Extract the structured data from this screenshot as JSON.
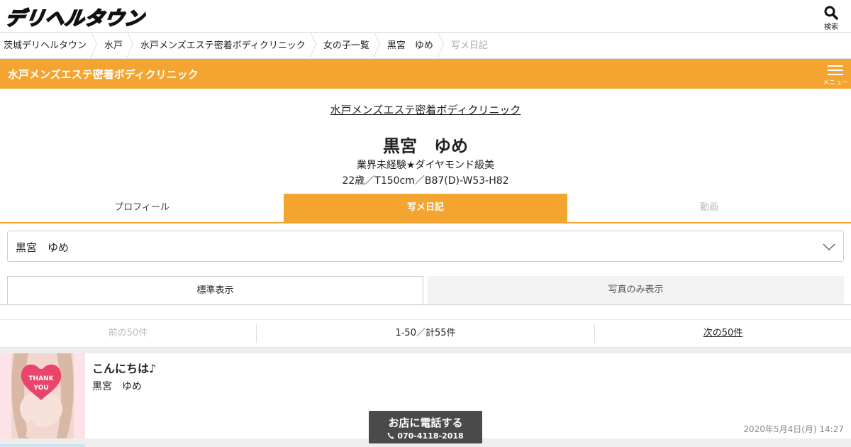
{
  "header": {
    "logo_text": "デリヘルタウン",
    "search_label": "検索"
  },
  "breadcrumb": [
    {
      "label": "茨城デリヘルタウン"
    },
    {
      "label": "水戸"
    },
    {
      "label": "水戸メンズエステ密着ボディクリニック"
    },
    {
      "label": "女の子一覧"
    },
    {
      "label": "黒宮　ゆめ"
    },
    {
      "label": "写メ日記"
    }
  ],
  "shop_bar": {
    "title": "水戸メンズエステ密着ボディクリニック",
    "menu_label": "メニュー"
  },
  "profile": {
    "shop_link": "水戸メンズエステ密着ボディクリニック",
    "name": "黒宮　ゆめ",
    "catch": "業界未経験★ダイヤモンド級美",
    "spec": "22歳／T150cm／B87(D)-W53-H82"
  },
  "tabs": [
    {
      "label": "プロフィール",
      "state": "normal"
    },
    {
      "label": "写メ日記",
      "state": "active"
    },
    {
      "label": "動画",
      "state": "disabled"
    }
  ],
  "girl_select": {
    "value": "黒宮　ゆめ"
  },
  "view_toggle": {
    "standard_label": "標準表示",
    "photo_only_label": "写真のみ表示"
  },
  "pager": {
    "prev_label": "前の50件",
    "count_label": "1-50／計55件",
    "next_label": "次の50件"
  },
  "diary_items": [
    {
      "title": "こんにちは♪",
      "author": "黒宮　ゆめ",
      "date": "2020年5月4日(月) 14:27",
      "thumb_text_1": "THANK",
      "thumb_text_2": "YOU"
    }
  ],
  "call_button": {
    "label": "お店に電話する",
    "phone": "070-4118-2018"
  },
  "colors": {
    "accent": "#f4a431",
    "call_bg": "#4a4a4a"
  }
}
